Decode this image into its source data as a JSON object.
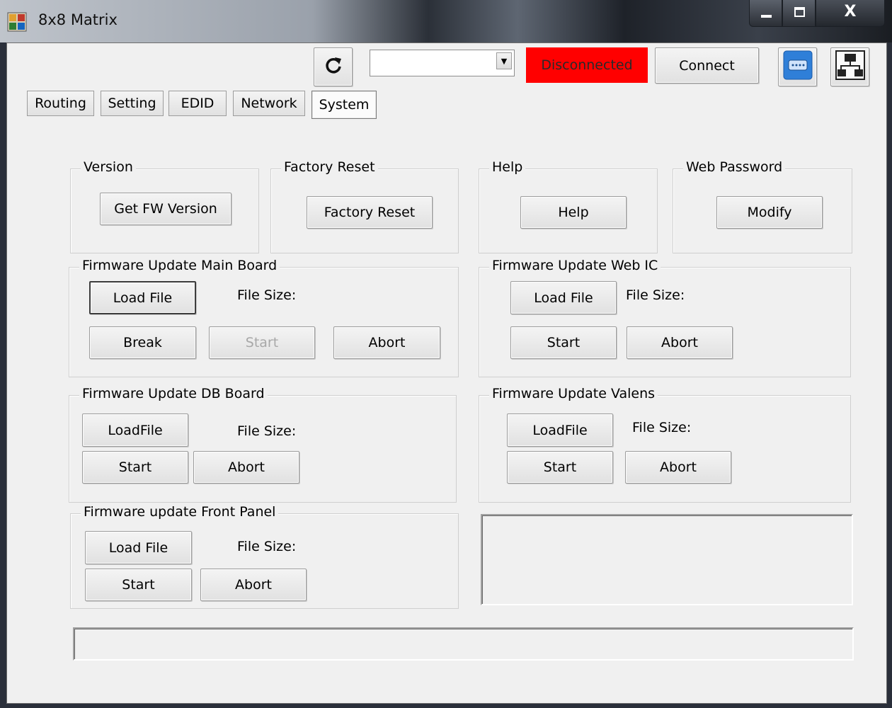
{
  "window": {
    "title": "8x8 Matrix",
    "close_glyph": "X",
    "icons": [
      "matrix-app-icon",
      "minimize-icon",
      "maximize-icon",
      "close-icon"
    ]
  },
  "toolbar": {
    "refresh_icon": "refresh-icon",
    "port_value": "",
    "status": "Disconnected",
    "status_color": "#ff0000",
    "connect_label": "Connect",
    "serial_icon": "serial-port-icon",
    "network_icon": "network-icon"
  },
  "tabs": [
    {
      "label": "Routing"
    },
    {
      "label": "Setting"
    },
    {
      "label": "EDID"
    },
    {
      "label": "Network"
    },
    {
      "label": "System",
      "active": true
    }
  ],
  "version": {
    "title": "Version",
    "button": "Get FW Version"
  },
  "factory_reset": {
    "title": "Factory Reset",
    "button": "Factory Reset"
  },
  "help": {
    "title": "Help",
    "button": "Help"
  },
  "web_password": {
    "title": "Web Password",
    "button": "Modify"
  },
  "fw_main": {
    "title": "Firmware Update Main Board",
    "load": "Load File",
    "file_size": "File Size:",
    "break": "Break",
    "start": "Start",
    "abort": "Abort"
  },
  "fw_web": {
    "title": "Firmware Update Web IC",
    "load": "Load File",
    "file_size": "File Size:",
    "start": "Start",
    "abort": "Abort"
  },
  "fw_db": {
    "title": "Firmware Update DB Board",
    "load": "LoadFile",
    "file_size": "File Size:",
    "start": "Start",
    "abort": "Abort"
  },
  "fw_valens": {
    "title": "Firmware Update Valens",
    "load": "LoadFile",
    "file_size": "File Size:",
    "start": "Start",
    "abort": "Abort"
  },
  "fw_front": {
    "title": "Firmware update Front Panel",
    "load": "Load File",
    "file_size": "File Size:",
    "start": "Start",
    "abort": "Abort"
  }
}
